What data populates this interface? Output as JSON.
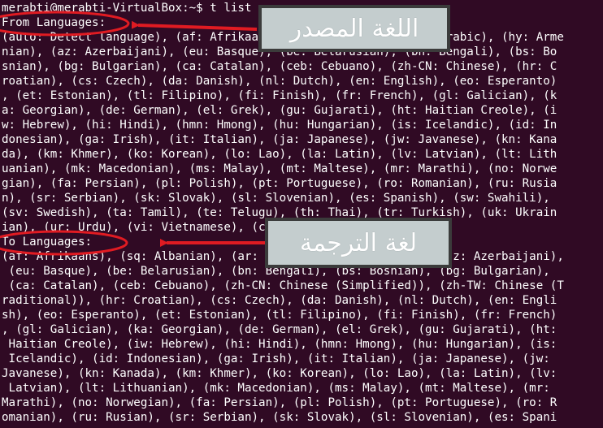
{
  "terminal": {
    "lines": [
      "merabti@merabti-VirtualBox:~$ t list",
      "From Languages:",
      "(auto: Detect language), (af: Afrikaans), (sq: Albanian), (ar: Arabic), (hy: Arme",
      "nian), (az: Azerbaijani), (eu: Basque), (be: Belarusian), (bn: Bengali), (bs: Bo",
      "snian), (bg: Bulgarian), (ca: Catalan), (ceb: Cebuano), (zh-CN: Chinese), (hr: C",
      "roatian), (cs: Czech), (da: Danish), (nl: Dutch), (en: English), (eo: Esperanto)",
      ", (et: Estonian), (tl: Filipino), (fi: Finish), (fr: French), (gl: Galician), (k",
      "a: Georgian), (de: German), (el: Grek), (gu: Gujarati), (ht: Haitian Creole), (i",
      "w: Hebrew), (hi: Hindi), (hmn: Hmong), (hu: Hungarian), (is: Icelandic), (id: In",
      "donesian), (ga: Irish), (it: Italian), (ja: Japanese), (jw: Javanese), (kn: Kana",
      "da), (km: Khmer), (ko: Korean), (lo: Lao), (la: Latin), (lv: Latvian), (lt: Lith",
      "uanian), (mk: Macedonian), (ms: Malay), (mt: Maltese), (mr: Marathi), (no: Norwe",
      "gian), (fa: Persian), (pl: Polish), (pt: Portuguese), (ro: Romanian), (ru: Rusia",
      "n), (sr: Serbian), (sk: Slovak), (sl: Slovenian), (es: Spanish), (sw: Swahili),",
      "(sv: Swedish), (ta: Tamil), (te: Telugu), (th: Thai), (tr: Turkish), (uk: Ukrain",
      "ian), (ur: Urdu), (vi: Vietnamese), (cy: Welsh)",
      "To Languages:",
      "(af: Afrikaans), (sq: Albanian), (ar: Arabic), (hy: Armenian), (az: Azerbaijani),",
      " (eu: Basque), (be: Belarusian), (bn: Bengali), (bs: Bosnian), (bg: Bulgarian),",
      " (ca: Catalan), (ceb: Cebuano), (zh-CN: Chinese (Simplified)), (zh-TW: Chinese (T",
      "raditional)), (hr: Croatian), (cs: Czech), (da: Danish), (nl: Dutch), (en: Engli",
      "sh), (eo: Esperanto), (et: Estonian), (tl: Filipino), (fi: Finish), (fr: French)",
      ", (gl: Galician), (ka: Georgian), (de: German), (el: Grek), (gu: Gujarati), (ht:",
      " Haitian Creole), (iw: Hebrew), (hi: Hindi), (hmn: Hmong), (hu: Hungarian), (is:",
      " Icelandic), (id: Indonesian), (ga: Irish), (it: Italian), (ja: Japanese), (jw:",
      "Javanese), (kn: Kanada), (km: Khmer), (ko: Korean), (lo: Lao), (la: Latin), (lv:",
      " Latvian), (lt: Lithuanian), (mk: Macedonian), (ms: Malay), (mt: Maltese), (mr:",
      "Marathi), (no: Norwegian), (fa: Persian), (pl: Polish), (pt: Portuguese), (ro: R",
      "omanian), (ru: Rusian), (sr: Serbian), (sk: Slovak), (sl: Slovenian), (es: Spani"
    ]
  },
  "annotations": {
    "from_label": "اللغة  المصدر",
    "to_label": "لغة الترجمة"
  },
  "colors": {
    "terminal_bg": "#300a24",
    "terminal_fg": "#ffffff",
    "annotation_red": "#e01b22",
    "callout_bg": "#c4cdce",
    "callout_border": "#3b3b3b"
  }
}
